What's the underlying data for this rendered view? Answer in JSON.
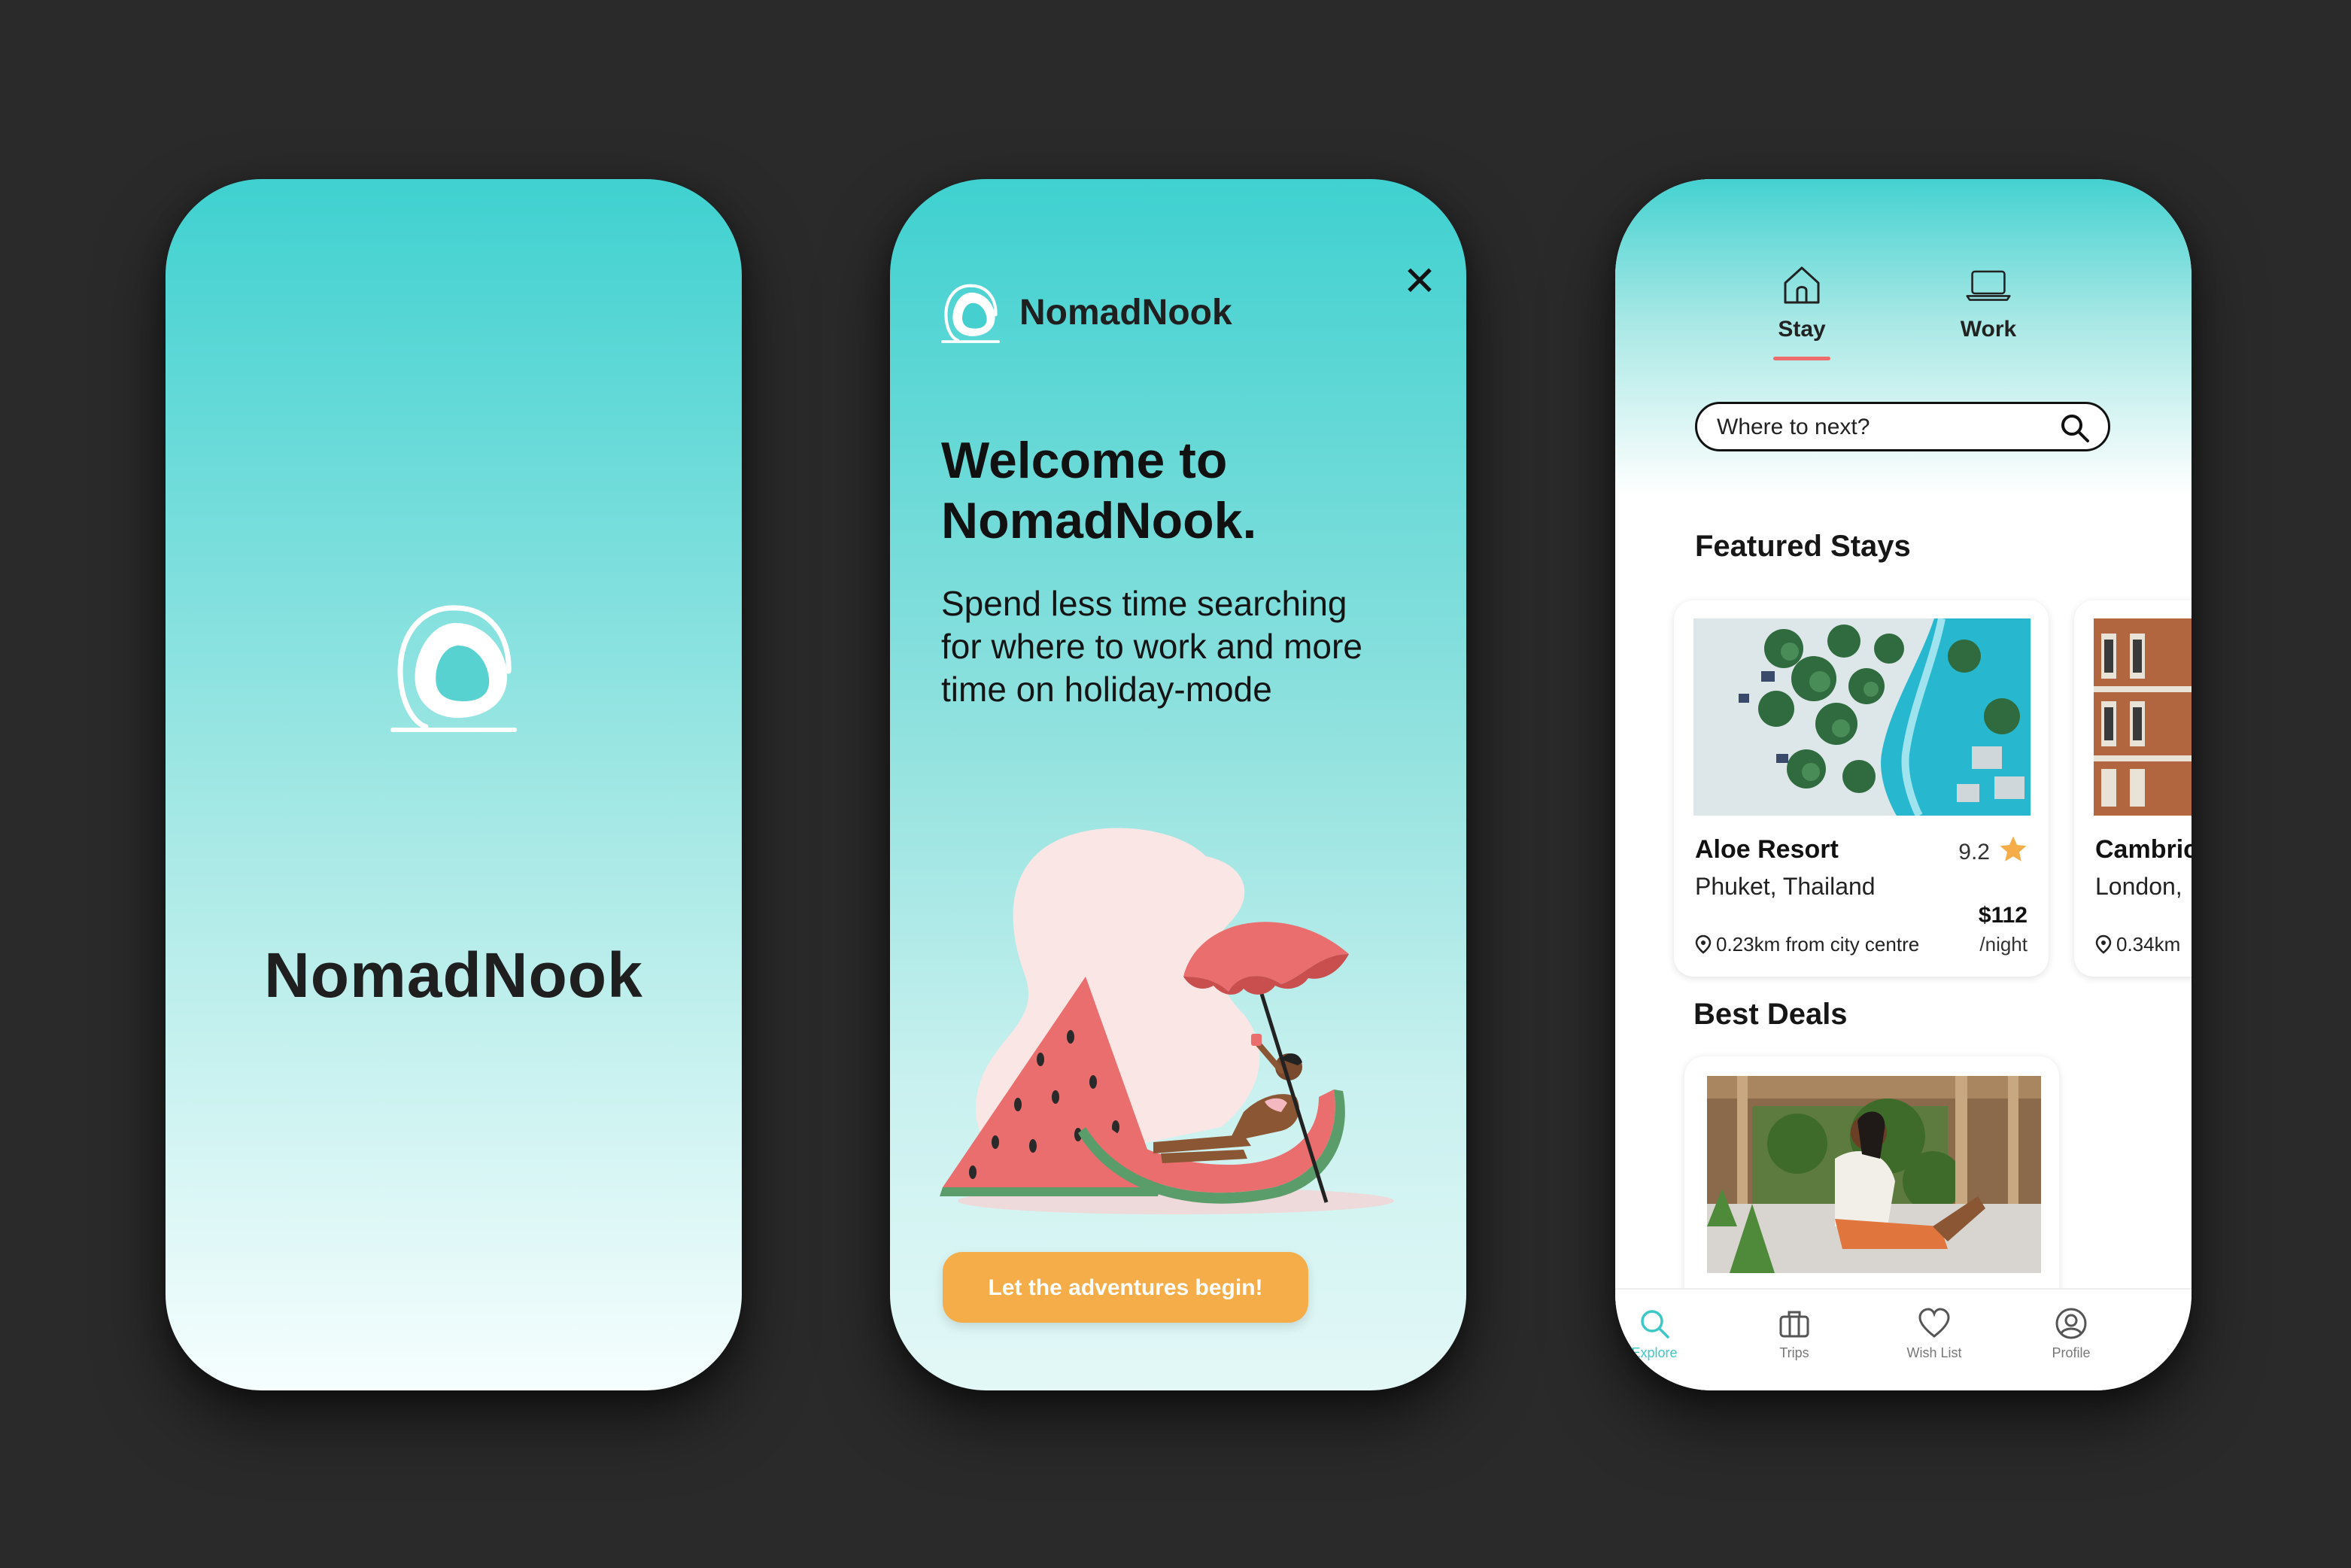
{
  "colors": {
    "teal": "#3fd1d0",
    "orange": "#f4ad48",
    "coral": "#ee6b6b",
    "star": "#f4ad48",
    "background": "#2a2a2a"
  },
  "splash": {
    "brand": "NomadNook",
    "logo_icon": "hanging-egg-chair-icon"
  },
  "welcome": {
    "brand": "NomadNook",
    "close_icon": "close-icon",
    "title": "Welcome to NomadNook.",
    "subtitle": "Spend less time searching for where to work and more time on holiday-mode",
    "illustration": "woman-lounging-on-watermelon-with-umbrella",
    "cta": "Let the adventures begin!"
  },
  "explore": {
    "mode_tabs": [
      {
        "label": "Stay",
        "icon": "house-icon",
        "active": true
      },
      {
        "label": "Work",
        "icon": "laptop-icon",
        "active": false
      }
    ],
    "search": {
      "placeholder": "Where to next?",
      "icon": "search-icon"
    },
    "featured_title": "Featured Stays",
    "featured": [
      {
        "name": "Aloe Resort",
        "rating": "9.2",
        "location": "Phuket, Thailand",
        "price": "$112",
        "per": "/night",
        "distance": "0.23km from city centre"
      },
      {
        "name": "Cambric",
        "location": "London,",
        "distance": "0.34km"
      }
    ],
    "deals_title": "Best Deals",
    "nav": [
      {
        "label": "Explore",
        "icon": "search-icon",
        "active": true
      },
      {
        "label": "Trips",
        "icon": "briefcase-icon",
        "active": false
      },
      {
        "label": "Wish List",
        "icon": "heart-icon",
        "active": false
      },
      {
        "label": "Profile",
        "icon": "user-circle-icon",
        "active": false
      }
    ]
  }
}
